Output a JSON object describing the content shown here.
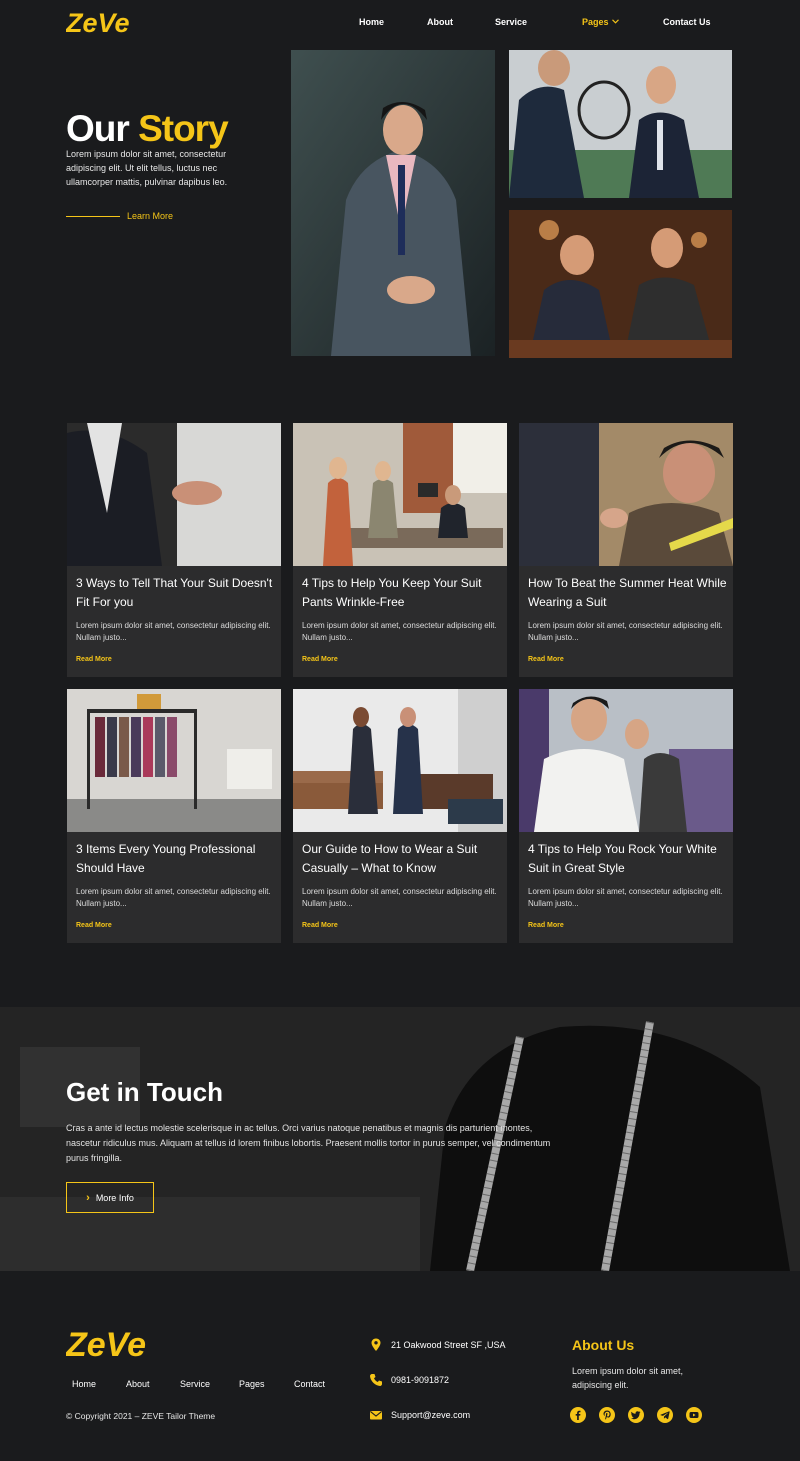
{
  "brand": {
    "logo_text": "ZeVe",
    "accent_color": "#f5c518",
    "background": "#1a1b1d"
  },
  "nav": {
    "items": [
      {
        "label": "Home"
      },
      {
        "label": "About"
      },
      {
        "label": "Service"
      },
      {
        "label": "Pages",
        "active": true,
        "icon": "chevron-down-icon"
      },
      {
        "label": "Contact Us"
      }
    ]
  },
  "hero": {
    "title_part1": "Our",
    "title_part2": "Story",
    "text": "Lorem ipsum dolor sit amet, consectetur adipiscing elit. Ut elit tellus, luctus nec ullamcorper mattis, pulvinar dapibus leo.",
    "link_label": "Learn More"
  },
  "posts": [
    {
      "title": "3 Ways to Tell That Your Suit Doesn't Fit For you",
      "excerpt": "Lorem ipsum dolor sit amet, consectetur adipiscing elit. Nullam justo...",
      "read_more": "Read More"
    },
    {
      "title": "4 Tips to Help You Keep Your Suit Pants Wrinkle-Free",
      "excerpt": "Lorem ipsum dolor sit amet, consectetur adipiscing elit. Nullam justo...",
      "read_more": "Read More"
    },
    {
      "title": "How To Beat the Summer Heat While Wearing a Suit",
      "excerpt": "Lorem ipsum dolor sit amet, consectetur adipiscing elit. Nullam justo...",
      "read_more": "Read More"
    },
    {
      "title": "3 Items Every Young Professional Should Have",
      "excerpt": "Lorem ipsum dolor sit amet, consectetur adipiscing elit. Nullam justo...",
      "read_more": "Read More"
    },
    {
      "title": "Our Guide to How to Wear a Suit Casually – What to Know",
      "excerpt": "Lorem ipsum dolor sit amet, consectetur adipiscing elit. Nullam justo...",
      "read_more": "Read More"
    },
    {
      "title": "4 Tips to Help You Rock Your White Suit in Great Style",
      "excerpt": "Lorem ipsum dolor sit amet, consectetur adipiscing elit. Nullam justo...",
      "read_more": "Read More"
    }
  ],
  "contact": {
    "title": "Get in Touch",
    "text": "Cras a ante id lectus molestie scelerisque in ac tellus. Orci varius natoque penatibus et magnis dis parturient montes, nascetur ridiculus mus. Aliquam at tellus id lorem finibus lobortis. Praesent mollis tortor in purus semper, vel condimentum purus fringilla.",
    "button_label": "More Info"
  },
  "footer": {
    "logo_text": "ZeVe",
    "nav": [
      {
        "label": "Home"
      },
      {
        "label": "About"
      },
      {
        "label": "Service"
      },
      {
        "label": "Pages"
      },
      {
        "label": "Contact"
      }
    ],
    "copyright": "© Copyright 2021 – ZEVE  Tailor Theme",
    "address": "21 Oakwood Street SF ,USA",
    "phone": "0981-9091872",
    "email": "Support@zeve.com",
    "about_title": "About Us",
    "about_text": "Lorem ipsum dolor sit amet, adipiscing elit.",
    "social": [
      "facebook-icon",
      "pinterest-icon",
      "twitter-icon",
      "telegram-icon",
      "youtube-icon"
    ]
  }
}
